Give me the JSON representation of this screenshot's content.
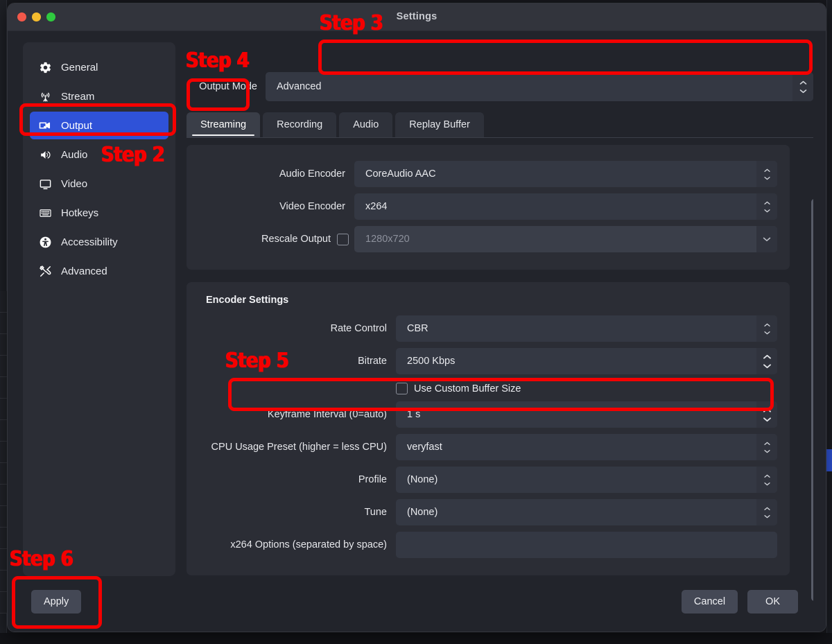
{
  "window": {
    "title": "Settings",
    "traffic_lights": [
      "close",
      "minimize",
      "zoom"
    ]
  },
  "sidebar": {
    "items": [
      {
        "label": "General",
        "icon": "gear-icon",
        "active": false
      },
      {
        "label": "Stream",
        "icon": "broadcast-icon",
        "active": false
      },
      {
        "label": "Output",
        "icon": "video-camera-icon",
        "active": true
      },
      {
        "label": "Audio",
        "icon": "speaker-icon",
        "active": false
      },
      {
        "label": "Video",
        "icon": "monitor-icon",
        "active": false
      },
      {
        "label": "Hotkeys",
        "icon": "keyboard-icon",
        "active": false
      },
      {
        "label": "Accessibility",
        "icon": "accessibility-icon",
        "active": false
      },
      {
        "label": "Advanced",
        "icon": "tools-icon",
        "active": false
      }
    ]
  },
  "output_mode": {
    "label": "Output Mode",
    "value": "Advanced"
  },
  "tabs": [
    {
      "label": "Streaming",
      "active": true
    },
    {
      "label": "Recording",
      "active": false
    },
    {
      "label": "Audio",
      "active": false
    },
    {
      "label": "Replay Buffer",
      "active": false
    }
  ],
  "top_section": {
    "audio_encoder": {
      "label": "Audio Encoder",
      "value": "CoreAudio AAC"
    },
    "video_encoder": {
      "label": "Video Encoder",
      "value": "x264"
    },
    "rescale_output": {
      "label": "Rescale Output",
      "value": "1280x720",
      "checked": false,
      "disabled": true
    }
  },
  "encoder_settings": {
    "title": "Encoder Settings",
    "rate_control": {
      "label": "Rate Control",
      "value": "CBR"
    },
    "bitrate": {
      "label": "Bitrate",
      "value": "2500 Kbps"
    },
    "use_custom_buffer_size": {
      "label": "Use Custom Buffer Size",
      "checked": false
    },
    "keyframe_interval": {
      "label": "Keyframe Interval (0=auto)",
      "value": "1 s"
    },
    "cpu_usage_preset": {
      "label": "CPU Usage Preset (higher = less CPU)",
      "value": "veryfast"
    },
    "profile": {
      "label": "Profile",
      "value": "(None)"
    },
    "tune": {
      "label": "Tune",
      "value": "(None)"
    },
    "x264_options": {
      "label": "x264 Options (separated by space)",
      "value": "",
      "placeholder": ""
    }
  },
  "footer": {
    "apply": "Apply",
    "cancel": "Cancel",
    "ok": "OK"
  },
  "annotations": {
    "accent_color": "#f50000",
    "steps": [
      {
        "label": "Step 2",
        "target": "sidebar-output-item"
      },
      {
        "label": "Step 3",
        "target": "output-mode-field"
      },
      {
        "label": "Step 4",
        "target": "streaming-tab"
      },
      {
        "label": "Step 5",
        "target": "keyframe-interval-row"
      },
      {
        "label": "Step 6",
        "target": "apply-button"
      }
    ]
  },
  "colors": {
    "window_bg": "#22242b",
    "sidebar_bg": "#2b2d35",
    "active_item": "#2f52d8",
    "field_bg": "#343843",
    "titlebar_bg": "#32343c"
  }
}
